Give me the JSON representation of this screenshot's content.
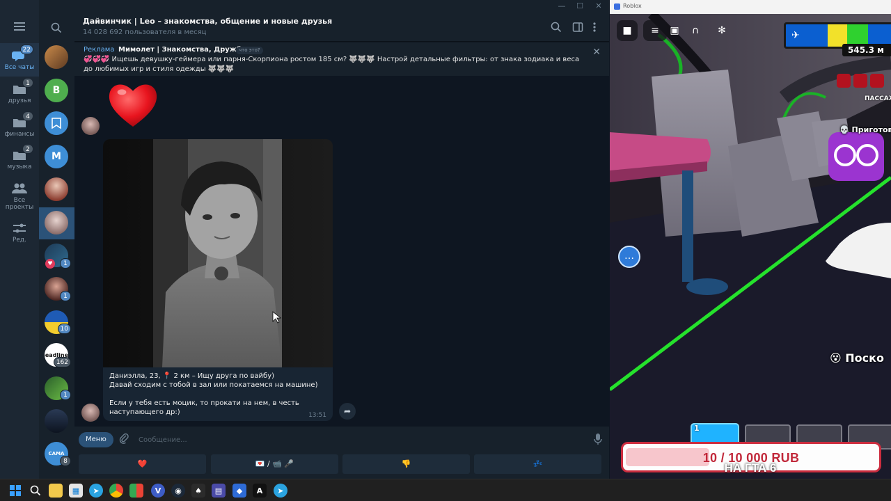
{
  "telegram": {
    "window_controls": {
      "minimize": "—",
      "maximize": "☐",
      "close": "✕"
    },
    "sidebar": {
      "items": [
        {
          "label": "Все чаты",
          "badge": "22",
          "active": true
        },
        {
          "label": "друзья",
          "badge": "1"
        },
        {
          "label": "финансы",
          "badge": "4"
        },
        {
          "label": "музыка",
          "badge": "2"
        },
        {
          "label": "Все проекты",
          "badge": ""
        },
        {
          "label": "Ред.",
          "badge": ""
        }
      ]
    },
    "chat_list": {
      "avatars": [
        {
          "letter": "",
          "color": "#7a5a3a",
          "badge": ""
        },
        {
          "letter": "B",
          "color": "#4fae4e",
          "badge": ""
        },
        {
          "letter": "",
          "color": "#3e8ed6",
          "badge": ""
        },
        {
          "letter": "M",
          "color": "#3e8ed6",
          "badge": ""
        },
        {
          "letter": "",
          "color": "#c9a08a",
          "badge": ""
        },
        {
          "letter": "",
          "color": "#b5a6a6",
          "badge": "",
          "selected": true
        },
        {
          "letter": "",
          "color": "#2b4f73",
          "badge": "1"
        },
        {
          "letter": "",
          "color": "#6b3b3b",
          "badge": "1"
        },
        {
          "letter": "",
          "color": "#d1b63a",
          "badge": "10"
        },
        {
          "letter": "headlines",
          "color": "#ffffff",
          "badge": "162"
        },
        {
          "letter": "",
          "color": "#3e7f3e",
          "badge": "1"
        },
        {
          "letter": "",
          "color": "#3a4a63",
          "badge": ""
        },
        {
          "letter": "САМА",
          "color": "#3e8ed6",
          "badge": "8"
        }
      ]
    },
    "header": {
      "title": "Дайвинчик | Leo – знакомства, общение и новые друзья",
      "subtitle": "14 028 692 пользователя в месяц"
    },
    "ad": {
      "label": "Реклама",
      "title": "Мимолет | Знакомства, Дружба",
      "what": "что это?",
      "text": "💞💞💞 Ищешь девушку-геймера или парня-Скорпиона ростом 185 см? 🐺🐺🐺 Настрой детальные фильтры: от знака зодиака и веса до любимых игр и стиля одежды 🐺🐺🐺"
    },
    "message": {
      "caption_line1": "Даниэлла, 23, 📍 2 км – Ищу друга по вайбу)",
      "caption_line2": "Давай сходим с тобой в зал или покатаемся на машине)",
      "caption_line3": "Если у тебя есть моцик, то прокати на нем, в честь наступающего др:)",
      "time": "13:51"
    },
    "composer": {
      "menu_label": "Меню",
      "placeholder": "Сообщение..."
    },
    "keyboard": {
      "buttons": [
        "❤️",
        "💌 / 📹 🎤",
        "👎",
        "💤"
      ]
    }
  },
  "roblox": {
    "window_title": "Roblox",
    "distance": "545.3 м",
    "passengers_label": "ПАССАЖ",
    "cooking_label": "💀 Приготов",
    "posk_label": "😵 Поско",
    "hotbar_first_slot": "1",
    "donation_goal": "10 / 10 000 RUB",
    "caption": "НА ГТА 6"
  },
  "taskbar": {
    "apps": [
      "start",
      "search",
      "file-explorer",
      "store",
      "telegram",
      "chrome",
      "chrome-red",
      "viber",
      "steam",
      "app-green",
      "app-purple",
      "app-blue",
      "app-a",
      "telegram-2"
    ]
  }
}
